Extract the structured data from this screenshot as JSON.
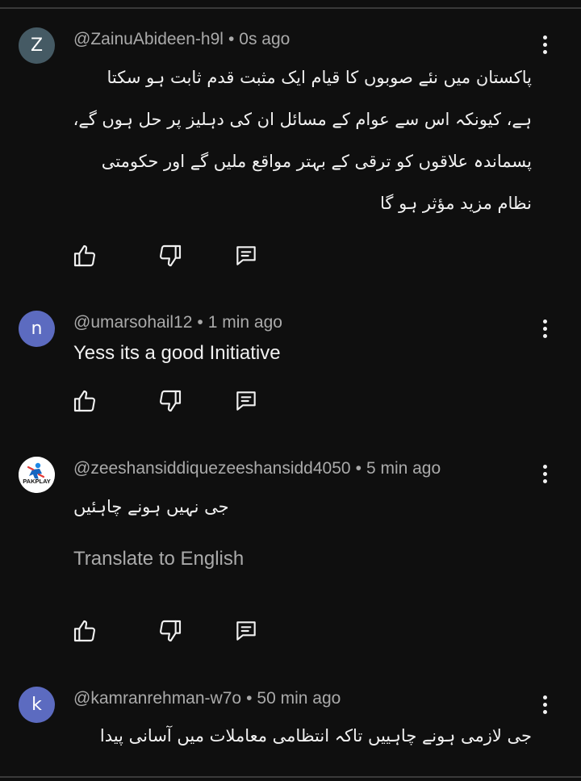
{
  "comments": [
    {
      "avatar_letter": "Z",
      "avatar_color": "#455a64",
      "author": "@ZainuAbideen-h9l",
      "time": "0s ago",
      "text_lines": [
        "پاکستان میں نئے صوبوں کا قیام ایک مثبت قدم ثابت ہو سکتا",
        "ہے، کیونکہ اس سے عوام کے مسائل ان کی دہلیز پر حل ہوں گے،",
        "پسماندہ علاقوں کو ترقی کے بہتر مواقع ملیں گے اور حکومتی",
        "نظام مزید مؤثر ہو گا"
      ]
    },
    {
      "avatar_letter": "n",
      "avatar_color": "#5c6bc0",
      "author": "@umarsohail12",
      "time": "1 min ago",
      "text": "Yess its a good Initiative"
    },
    {
      "avatar_label": "PAKPLAY",
      "author": "@zeeshansiddiquezeeshansidd4050",
      "time": "5 min ago",
      "text": "جی نہیں ہونے چاہئیں",
      "translate_label": "Translate to English"
    },
    {
      "avatar_letter": "k",
      "avatar_color": "#5c6bc0",
      "author": "@kamranrehman-w7o",
      "time": "50 min ago",
      "text_lines": [
        "جی لازمی ہونے چاہییں تاکہ انتظامی معاملات میں آسانی پیدا"
      ]
    }
  ],
  "icons": {
    "like": "thumb-up-icon",
    "dislike": "thumb-down-icon",
    "reply": "reply-icon",
    "more": "more-vert-icon"
  },
  "colors": {
    "background": "#0f0f0f",
    "primary_text": "#f1f1f1",
    "secondary_text": "#aaaaaa"
  }
}
